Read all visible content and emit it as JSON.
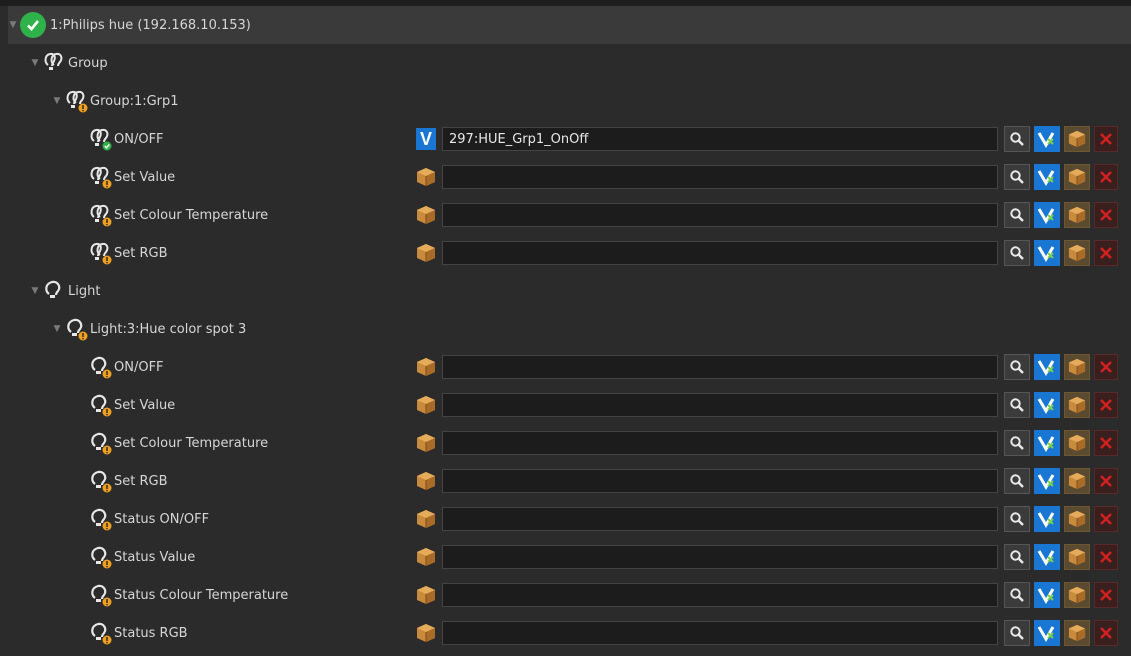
{
  "tree": {
    "root": {
      "label": "1:Philips hue (192.168.10.153)"
    },
    "group": {
      "label": "Group",
      "child": {
        "label": "Group:1:Grp1",
        "items": [
          {
            "label": "ON/OFF",
            "value": "297:HUE_Grp1_OnOff",
            "source": "v-icon"
          },
          {
            "label": "Set Value",
            "value": "",
            "source": "box-icon"
          },
          {
            "label": "Set Colour Temperature",
            "value": "",
            "source": "box-icon"
          },
          {
            "label": "Set RGB",
            "value": "",
            "source": "box-icon"
          }
        ]
      }
    },
    "light": {
      "label": "Light",
      "child": {
        "label": "Light:3:Hue color spot 3",
        "items": [
          {
            "label": "ON/OFF",
            "value": "",
            "source": "box-icon"
          },
          {
            "label": "Set Value",
            "value": "",
            "source": "box-icon"
          },
          {
            "label": "Set Colour Temperature",
            "value": "",
            "source": "box-icon"
          },
          {
            "label": "Set RGB",
            "value": "",
            "source": "box-icon"
          },
          {
            "label": "Status ON/OFF",
            "value": "",
            "source": "box-icon"
          },
          {
            "label": "Status Value",
            "value": "",
            "source": "box-icon"
          },
          {
            "label": "Status Colour Temperature",
            "value": "",
            "source": "box-icon"
          },
          {
            "label": "Status RGB",
            "value": "",
            "source": "box-icon"
          }
        ]
      }
    }
  },
  "colors": {
    "background": "#2b2b2b",
    "header": "#3a3a3a",
    "field": "#1c1c1c",
    "accent_blue": "#1976d2",
    "ok_green": "#2fb24a",
    "warn_orange": "#f0a020"
  },
  "icons": [
    "expand-arrow-icon",
    "status-ok-icon",
    "bulb-group-icon",
    "bulb-icon",
    "v-icon",
    "box-icon",
    "search-icon",
    "link-icon",
    "box-icon",
    "delete-icon"
  ]
}
